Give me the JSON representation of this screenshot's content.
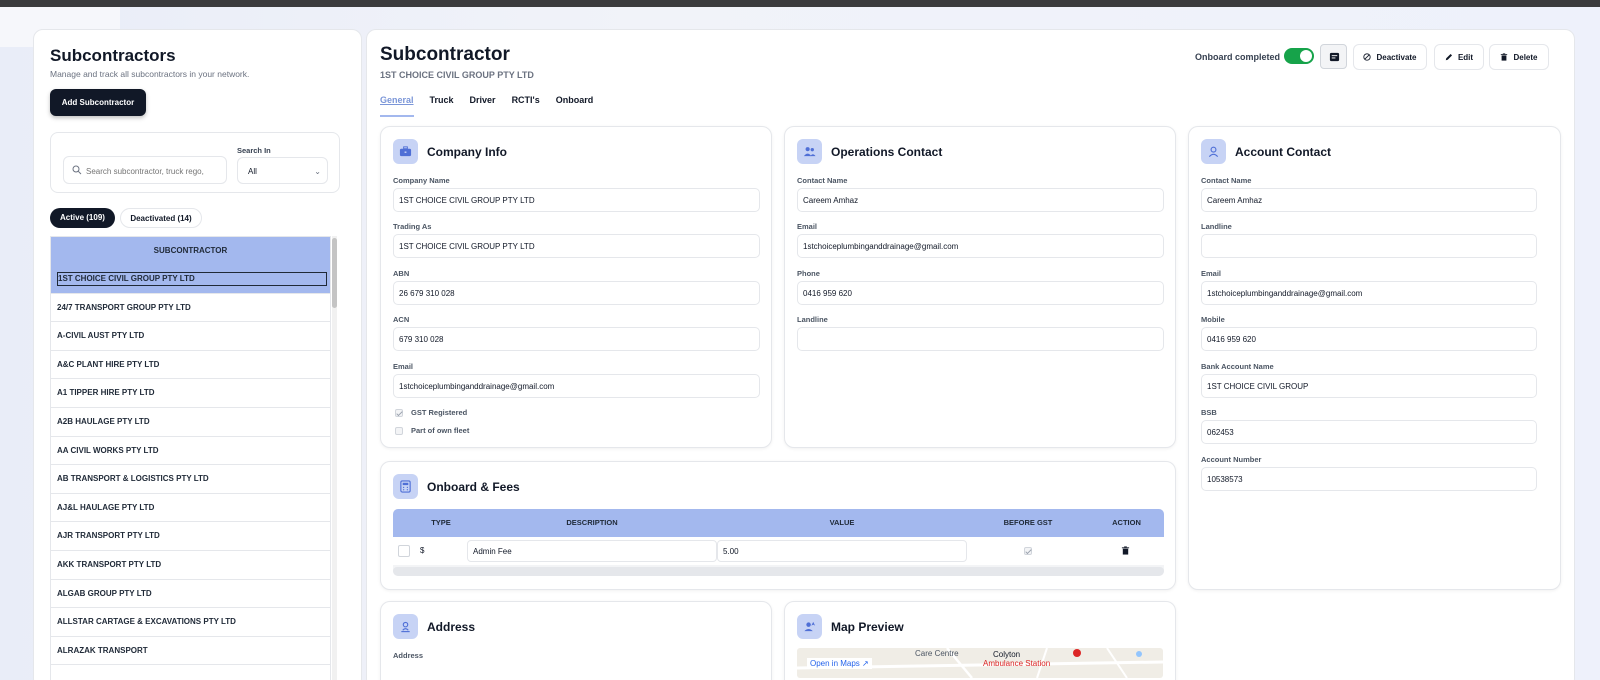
{
  "sidebar": {
    "title": "Subcontractors",
    "subtitle": "Manage and track all subcontractors in your network.",
    "add_button": "Add Subcontractor",
    "search_placeholder": "Search subcontractor, truck rego,",
    "search_in_label": "Search In",
    "search_in_value": "All",
    "tabs": {
      "active": "Active (109)",
      "deactivated": "Deactivated (14)"
    },
    "table_header": "SUBCONTRACTOR",
    "rows": [
      "1ST CHOICE CIVIL GROUP PTY LTD",
      "24/7 TRANSPORT GROUP PTY LTD",
      "A-CIVIL AUST PTY LTD",
      "A&C PLANT HIRE PTY LTD",
      "A1 TIPPER HIRE PTY LTD",
      "A2B HAULAGE PTY LTD",
      "AA CIVIL WORKS PTY LTD",
      "AB TRANSPORT & LOGISTICS PTY LTD",
      "AJ&L HAULAGE PTY LTD",
      "AJR TRANSPORT PTY LTD",
      "AKK TRANSPORT PTY LTD",
      "ALGAB GROUP PTY LTD",
      "ALLSTAR CARTAGE & EXCAVATIONS PTY LTD",
      "ALRAZAK TRANSPORT"
    ]
  },
  "main": {
    "title": "Subcontractor",
    "subtitle": "1ST CHOICE CIVIL GROUP PTY LTD",
    "tabs": [
      "General",
      "Truck",
      "Driver",
      "RCTI's",
      "Onboard"
    ],
    "onboard_label": "Onboard completed",
    "onboard_completed": true,
    "buttons": {
      "deactivate": "Deactivate",
      "edit": "Edit",
      "delete": "Delete"
    }
  },
  "company_info": {
    "title": "Company Info",
    "company_name_label": "Company Name",
    "company_name": "1ST CHOICE CIVIL GROUP PTY LTD",
    "trading_as_label": "Trading As",
    "trading_as": "1ST CHOICE CIVIL GROUP PTY LTD",
    "abn_label": "ABN",
    "abn": "26 679 310 028",
    "acn_label": "ACN",
    "acn": "679 310 028",
    "email_label": "Email",
    "email": "1stchoiceplumbinganddrainage@gmail.com",
    "gst_label": "GST Registered",
    "gst": true,
    "fleet_label": "Part of own fleet",
    "fleet": false
  },
  "operations_contact": {
    "title": "Operations Contact",
    "contact_name_label": "Contact Name",
    "contact_name": "Careem Amhaz",
    "email_label": "Email",
    "email": "1stchoiceplumbinganddrainage@gmail.com",
    "phone_label": "Phone",
    "phone": "0416 959 620",
    "landline_label": "Landline",
    "landline": ""
  },
  "account_contact": {
    "title": "Account Contact",
    "contact_name_label": "Contact Name",
    "contact_name": "Careem Amhaz",
    "landline_label": "Landline",
    "landline": "",
    "email_label": "Email",
    "email": "1stchoiceplumbinganddrainage@gmail.com",
    "mobile_label": "Mobile",
    "mobile": "0416 959 620",
    "bank_name_label": "Bank Account Name",
    "bank_name": "1ST CHOICE CIVIL GROUP",
    "bsb_label": "BSB",
    "bsb": "062453",
    "account_number_label": "Account Number",
    "account_number": "10538573"
  },
  "onboard_fees": {
    "title": "Onboard & Fees",
    "headers": {
      "type": "TYPE",
      "description": "DESCRIPTION",
      "value": "VALUE",
      "before_gst": "BEFORE GST",
      "action": "ACTION"
    },
    "row": {
      "type": "$",
      "description": "Admin Fee",
      "value": "5.00"
    }
  },
  "address": {
    "title": "Address",
    "label": "Address"
  },
  "map_preview": {
    "title": "Map Preview",
    "open_maps": "Open in Maps",
    "labels": [
      "Care Centre",
      "Colyton",
      "Ambulance Station"
    ]
  },
  "colors": {
    "accent": "#a3b8ee",
    "primary": "#111827",
    "toggle": "#16a34a"
  }
}
